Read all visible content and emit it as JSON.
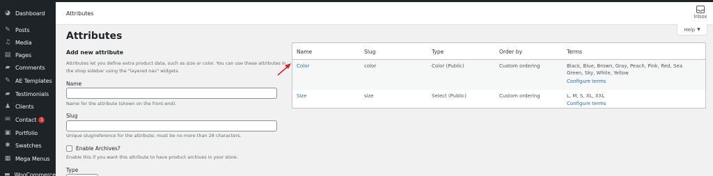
{
  "sidebar": {
    "items": [
      {
        "label": "Dashboard",
        "icon": "dashboard-icon",
        "glyph": "◕"
      },
      {
        "label": "Posts",
        "icon": "pushpin-icon",
        "glyph": "✎"
      },
      {
        "label": "Media",
        "icon": "media-icon",
        "glyph": "♫"
      },
      {
        "label": "Pages",
        "icon": "pages-icon",
        "glyph": "▤"
      },
      {
        "label": "Comments",
        "icon": "comment-icon",
        "glyph": "▰"
      },
      {
        "label": "AE Templates",
        "icon": "pushpin-icon",
        "glyph": "✎"
      },
      {
        "label": "Testimonials",
        "icon": "testimonial-icon",
        "glyph": "▰"
      },
      {
        "label": "Clients",
        "icon": "users-icon",
        "glyph": "♟"
      },
      {
        "label": "Contact",
        "icon": "mail-icon",
        "glyph": "✉",
        "badge": "1"
      },
      {
        "label": "Portfolio",
        "icon": "portfolio-icon",
        "glyph": "▣"
      },
      {
        "label": "Swatches",
        "icon": "gear-icon",
        "glyph": "✱"
      },
      {
        "label": "Mega Menus",
        "icon": "menu-icon",
        "glyph": "▦"
      },
      {
        "label": "WooCommerce",
        "icon": "woocommerce-icon",
        "glyph": "▬"
      }
    ]
  },
  "header": {
    "title": "Attributes",
    "inbox_label": "Inbox"
  },
  "help": {
    "label": "Help",
    "caret": "▼"
  },
  "page": {
    "title": "Attributes"
  },
  "form": {
    "heading": "Add new attribute",
    "intro": "Attributes let you define extra product data, such as size or color. You can use these attributes in the shop sidebar using the \"layered nav\" widgets.",
    "name_label": "Name",
    "name_value": "",
    "name_desc": "Name for the attribute (shown on the front-end).",
    "slug_label": "Slug",
    "slug_value": "",
    "slug_desc": "Unique slug/reference for the attribute; must be no more than 28 characters.",
    "archives_label": "Enable Archives?",
    "archives_checked": false,
    "archives_desc": "Enable this if you want this attribute to have product archives in your store.",
    "type_label": "Type"
  },
  "table": {
    "headers": [
      "Name",
      "Slug",
      "Type",
      "Order by",
      "Terms"
    ],
    "rows": [
      {
        "name": "Color",
        "slug": "color",
        "type": "Color (Public)",
        "order": "Custom ordering",
        "terms": "Black, Blue, Brown, Gray, Peach, Pink, Red, Sea Green, Sky, White, Yellow",
        "configure": "Configure terms"
      },
      {
        "name": "Size",
        "slug": "size",
        "type": "Select (Public)",
        "order": "Custom ordering",
        "terms": "L, M, S, XL, XXL",
        "configure": "Configure terms"
      }
    ]
  },
  "colors": {
    "sidebar_bg": "#1d2327",
    "link": "#2271b1",
    "badge": "#d63638",
    "arrow": "#e02020"
  }
}
